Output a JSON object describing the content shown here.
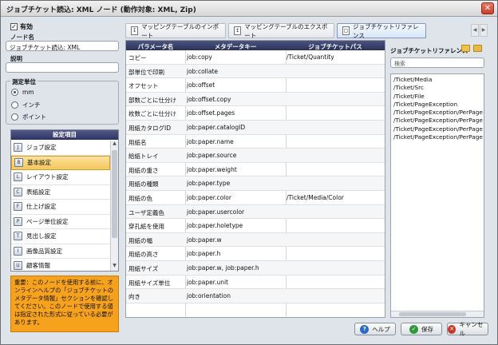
{
  "window": {
    "title": "ジョブチケット読込: XML ノード (動作対象: XML, Zip)",
    "close_label": "✕"
  },
  "left": {
    "enabled_label": "有効",
    "node_name_label": "ノード名",
    "node_name_value": "ジョブチケット読込: XML",
    "description_label": "説明",
    "description_value": "",
    "units_label": "測定単位",
    "units": [
      "mm",
      "インチ",
      "ポイント"
    ],
    "units_selected": 0,
    "settings_header": "設定項目",
    "settings_items": [
      {
        "label": "ジョブ設定",
        "icon": "job-icon"
      },
      {
        "label": "基本設定",
        "icon": "basic-icon"
      },
      {
        "label": "レイアウト設定",
        "icon": "layout-icon"
      },
      {
        "label": "表紙設定",
        "icon": "cover-icon"
      },
      {
        "label": "仕上げ設定",
        "icon": "finishing-icon"
      },
      {
        "label": "ページ単位設定",
        "icon": "page-exception-icon"
      },
      {
        "label": "見出し設定",
        "icon": "tab-icon"
      },
      {
        "label": "画像品質設定",
        "icon": "image-quality-icon"
      },
      {
        "label": "顧客情報",
        "icon": "customer-icon"
      }
    ],
    "warning_text": "重要：このノードを使用する前に、オンラインヘルプの「ジョブチケットのメタデータ情報」セクションを確認してください。このノードで使用する値は指定された形式に従っている必要があります。"
  },
  "tabs": [
    {
      "label": "マッピングテーブルのインポート",
      "icon": "import-icon"
    },
    {
      "label": "マッピングテーブルのエクスポート",
      "icon": "export-icon"
    },
    {
      "label": "ジョブチケットリファレンス",
      "icon": "reference-icon"
    }
  ],
  "table": {
    "headers": [
      "パラメータ名",
      "メタデータキー",
      "ジョブチケットパス"
    ],
    "rows": [
      [
        "コピー",
        "job:copy",
        "/Ticket/Quantity"
      ],
      [
        "部単位で印刷",
        "job:collate",
        ""
      ],
      [
        "オフセット",
        "job:offset",
        ""
      ],
      [
        "部数ごとに仕分け",
        "job:offset.copy",
        ""
      ],
      [
        "枚数ごとに仕分け",
        "job:offset.pages",
        ""
      ],
      [
        "用紙カタログID",
        "job:paper.catalogID",
        ""
      ],
      [
        "用紙名",
        "job:paper.name",
        ""
      ],
      [
        "給紙トレイ",
        "job:paper.source",
        ""
      ],
      [
        "用紙の重さ",
        "job:paper.weight",
        ""
      ],
      [
        "用紙の種類",
        "job:paper.type",
        ""
      ],
      [
        "用紙の色",
        "job:paper.color",
        "/Ticket/Media/Color"
      ],
      [
        "ユーザ定義色",
        "job:paper.usercolor",
        ""
      ],
      [
        "穿孔紙を使用",
        "job:paper.holetype",
        ""
      ],
      [
        "用紙の幅",
        "job:paper.w",
        ""
      ],
      [
        "用紙の高さ",
        "job:paper.h",
        ""
      ],
      [
        "用紙サイズ",
        "job:paper.w, job:paper.h",
        ""
      ],
      [
        "用紙サイズ単位",
        "job:paper.unit",
        ""
      ],
      [
        "向き",
        "job:orientation",
        ""
      ]
    ]
  },
  "reference": {
    "title": "ジョブチケットリファレンス",
    "search_placeholder": "検索",
    "items": [
      "/Ticket/Media",
      "/Ticket/Src",
      "/Ticket/File",
      "/Ticket/PageException",
      "/Ticket/PageException/PerPage",
      "/Ticket/PageException/PerPage",
      "/Ticket/PageException/PerPage",
      "/Ticket/PageException/PerPage"
    ]
  },
  "buttons": {
    "help": "ヘルプ",
    "save": "保存",
    "cancel": "キャンセル"
  },
  "colors": {
    "warning": "#f7a21c",
    "header": "#2b3158",
    "selected_item": "#f4c65d"
  }
}
